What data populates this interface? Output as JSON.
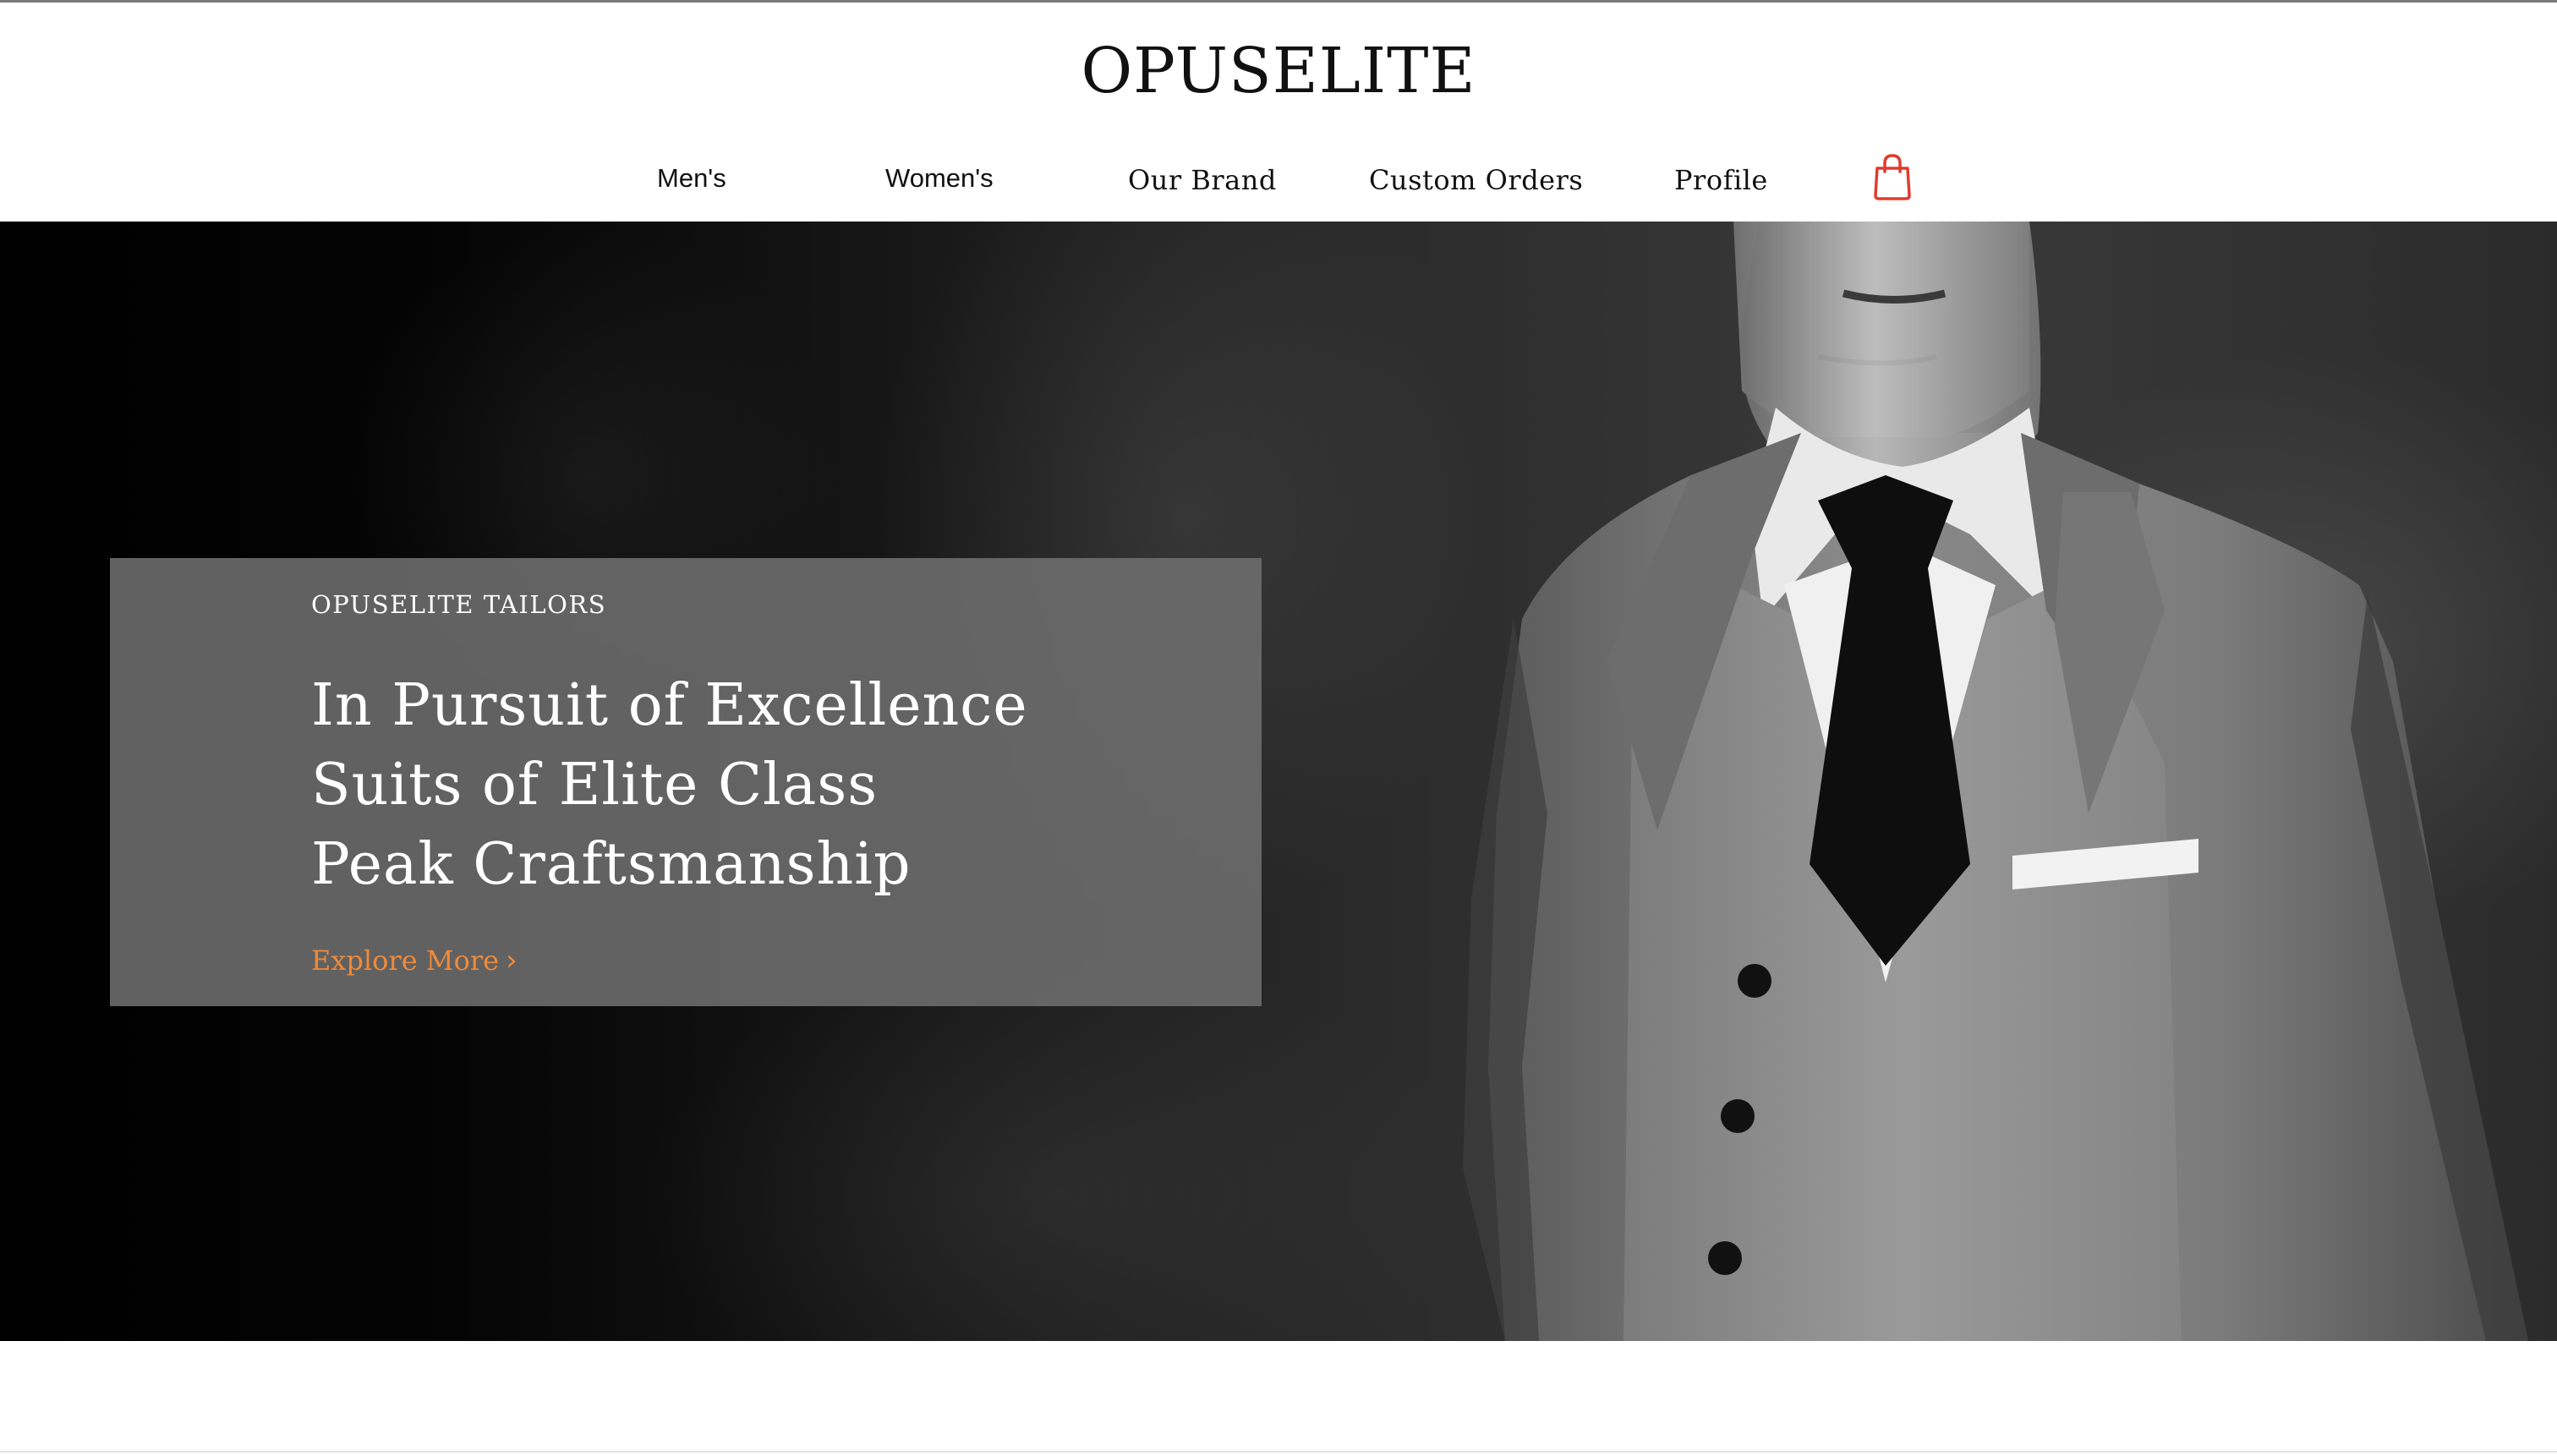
{
  "brand": {
    "name": "OPUSELITE"
  },
  "nav": {
    "items": [
      {
        "label": "Men's"
      },
      {
        "label": "Women's"
      },
      {
        "label": "Our Brand"
      },
      {
        "label": "Custom Orders"
      },
      {
        "label": "Profile"
      }
    ],
    "cart_icon": "shopping-bag-icon",
    "cart_color": "#e03c2e"
  },
  "hero": {
    "eyebrow": "OPUSELITE TAILORS",
    "headline": [
      "In Pursuit of Excellence",
      "Suits of Elite Class",
      "Peak Craftsmanship"
    ],
    "cta_label": "Explore More",
    "cta_icon": "chevron-right-icon",
    "cta_color": "#f08a3a"
  }
}
